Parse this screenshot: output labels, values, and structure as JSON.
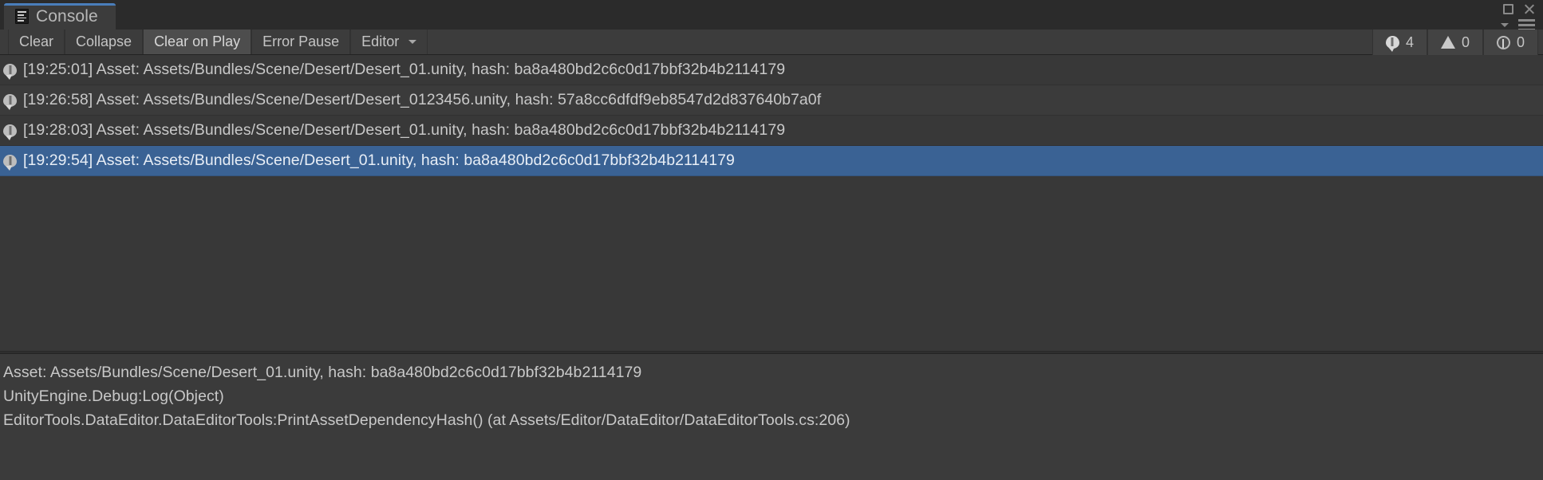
{
  "window": {
    "tab_label": "Console",
    "tab_icon": "console-icon",
    "maximize_icon": "maximize-icon",
    "close_icon": "close-icon",
    "menu_icon": "hamburger-menu-icon",
    "menu_chevron_icon": "chevron-down-icon",
    "accent_color": "#4a7ebb"
  },
  "toolbar": {
    "clear_label": "Clear",
    "collapse_label": "Collapse",
    "clear_on_play_label": "Clear on Play",
    "error_pause_label": "Error Pause",
    "editor_label": "Editor",
    "editor_caret_icon": "chevron-down-icon",
    "counters": [
      {
        "icon": "error-bubble-icon",
        "count": "4"
      },
      {
        "icon": "warning-triangle-icon",
        "count": "0"
      },
      {
        "icon": "info-circle-icon",
        "count": "0"
      }
    ]
  },
  "log": {
    "entries": [
      {
        "icon": "log-bubble-icon",
        "text": "[19:25:01] Asset: Assets/Bundles/Scene/Desert/Desert_01.unity, hash: ba8a480bd2c6c0d17bbf32b4b2114179",
        "selected": false
      },
      {
        "icon": "log-bubble-icon",
        "text": "[19:26:58] Asset: Assets/Bundles/Scene/Desert/Desert_0123456.unity, hash: 57a8cc6dfdf9eb8547d2d837640b7a0f",
        "selected": false
      },
      {
        "icon": "log-bubble-icon",
        "text": "[19:28:03] Asset: Assets/Bundles/Scene/Desert/Desert_01.unity, hash: ba8a480bd2c6c0d17bbf32b4b2114179",
        "selected": false
      },
      {
        "icon": "log-bubble-icon",
        "text": "[19:29:54] Asset: Assets/Bundles/Scene/Desert_01.unity, hash: ba8a480bd2c6c0d17bbf32b4b2114179",
        "selected": true
      }
    ]
  },
  "detail": {
    "lines": [
      "Asset: Assets/Bundles/Scene/Desert_01.unity, hash: ba8a480bd2c6c0d17bbf32b4b2114179",
      "UnityEngine.Debug:Log(Object)",
      "EditorTools.DataEditor.DataEditorTools:PrintAssetDependencyHash() (at Assets/Editor/DataEditor/DataEditorTools.cs:206)"
    ]
  }
}
